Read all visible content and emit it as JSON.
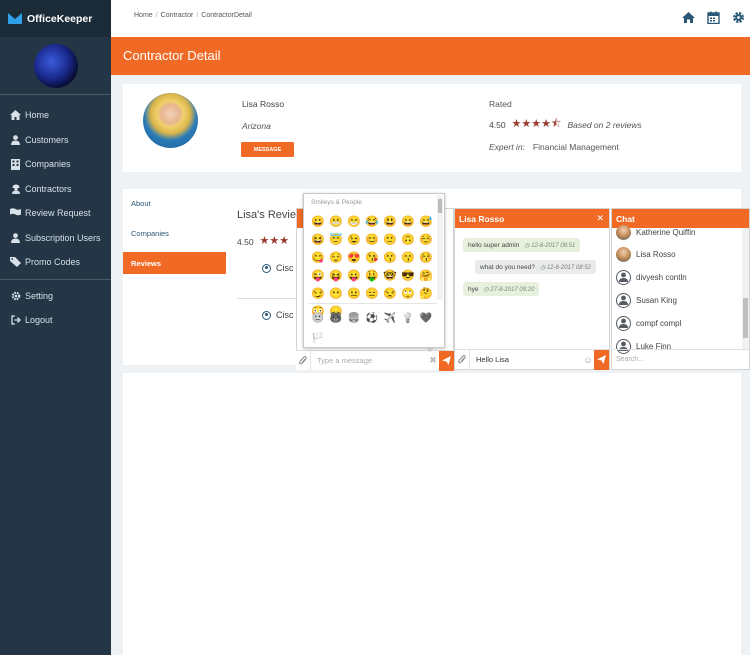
{
  "app": {
    "name": "OfficeKeeper"
  },
  "sidebar": {
    "items": [
      {
        "label": "Home",
        "icon": "home-icon"
      },
      {
        "label": "Customers",
        "icon": "user-icon"
      },
      {
        "label": "Companies",
        "icon": "building-icon"
      },
      {
        "label": "Contractors",
        "icon": "contractor-icon"
      },
      {
        "label": "Review Request",
        "icon": "flag-icon"
      },
      {
        "label": "Subscription Users",
        "icon": "user-icon"
      },
      {
        "label": "Promo Codes",
        "icon": "tag-icon"
      },
      {
        "label": "Setting",
        "icon": "gear-icon"
      },
      {
        "label": "Logout",
        "icon": "logout-icon"
      }
    ]
  },
  "breadcrumb": {
    "items": [
      "Home",
      "Contractor",
      "ContractorDetail"
    ]
  },
  "page": {
    "title": "Contractor Detail"
  },
  "profile": {
    "name": "Lisa Rosso",
    "location": "Arizona",
    "message_button": "MESSAGE",
    "rated_label": "Rated",
    "rating": "4.50",
    "stars": 4.5,
    "reviews_text": "Based on 2 reviews",
    "expert_label": "Expert in:",
    "expert_value": "Financial Management"
  },
  "tabs": [
    {
      "label": "About",
      "active": false
    },
    {
      "label": "Companies",
      "active": false
    },
    {
      "label": "Reviews",
      "active": true
    }
  ],
  "reviews": {
    "title": "Lisa's Review",
    "score": "4.50",
    "items": [
      "Cisc",
      "Cisc"
    ]
  },
  "emoji_picker": {
    "title": "Smileys & People",
    "emojis": [
      "😀",
      "😬",
      "😁",
      "😂",
      "😃",
      "😄",
      "😅",
      "😆",
      "😇",
      "😉",
      "😊",
      "🙂",
      "🙃",
      "☺️",
      "😋",
      "😌",
      "😍",
      "😘",
      "😗",
      "😙",
      "😚",
      "😜",
      "😝",
      "😛",
      "🤑",
      "🤓",
      "😎",
      "🤗",
      "😏",
      "😶",
      "😐",
      "😑",
      "😒",
      "🙄",
      "🤔",
      "😳",
      "😞"
    ],
    "categories": [
      "🙂",
      "🐻",
      "🍔",
      "⚽",
      "✈️",
      "💡",
      "❤️",
      "🏳️"
    ]
  },
  "emoji_chat": {
    "placeholder": "Type a message",
    "clear": "✖"
  },
  "chat": {
    "title": "Lisa Rosso",
    "close": "✕",
    "messages": [
      {
        "text": "hello super admin",
        "time": "12-8-2017 08:51",
        "direction": "in"
      },
      {
        "text": "what do you need?",
        "time": "12-8-2017 08:52",
        "direction": "out"
      },
      {
        "text": "hye",
        "time": "27-8-2017 09:20",
        "direction": "in"
      }
    ],
    "input_value": "Hello Lisa"
  },
  "contacts": {
    "title": "Chat",
    "items": [
      {
        "name": "Katherine Quiffin",
        "photo": true
      },
      {
        "name": "Lisa Rosso",
        "photo": true
      },
      {
        "name": "divyesh contln",
        "photo": false
      },
      {
        "name": "Susan King",
        "photo": false
      },
      {
        "name": "compf compl",
        "photo": false
      },
      {
        "name": "Luke Finn",
        "photo": false
      }
    ],
    "search_placeholder": "Search..."
  },
  "colors": {
    "accent": "#f06a25",
    "sidebar": "#243646",
    "star": "#9a3b2e"
  }
}
